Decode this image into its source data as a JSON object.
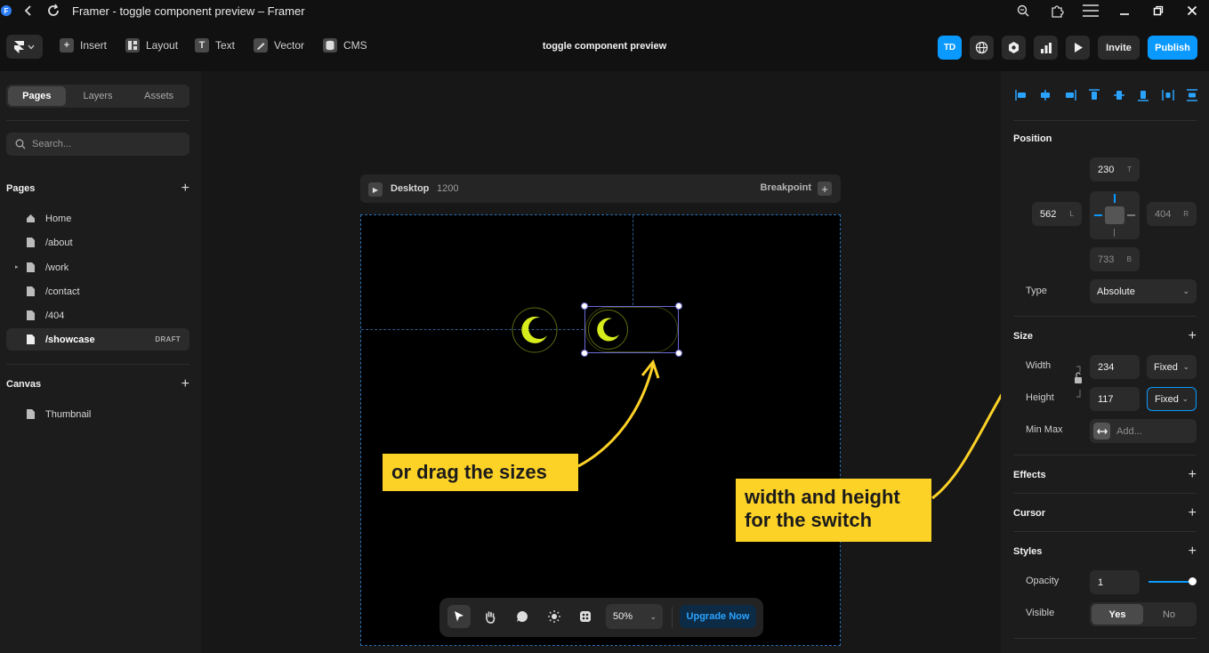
{
  "window": {
    "title": "Framer - toggle component preview – Framer"
  },
  "toolbar": {
    "insert": "Insert",
    "layout": "Layout",
    "text": "Text",
    "vector": "Vector",
    "cms": "CMS",
    "project_title": "toggle component preview",
    "avatar": "TD",
    "invite": "Invite",
    "publish": "Publish"
  },
  "left": {
    "tabs": [
      "Pages",
      "Layers",
      "Assets"
    ],
    "search_placeholder": "Search...",
    "pages_heading": "Pages",
    "pages": [
      {
        "label": "Home",
        "icon": "home-icon"
      },
      {
        "label": "/about",
        "icon": "page-icon"
      },
      {
        "label": "/work",
        "icon": "page-icon"
      },
      {
        "label": "/contact",
        "icon": "page-icon"
      },
      {
        "label": "/404",
        "icon": "page-icon"
      },
      {
        "label": "/showcase",
        "icon": "page-icon",
        "badge": "DRAFT"
      }
    ],
    "canvas_heading": "Canvas",
    "canvas_items": [
      "Thumbnail"
    ]
  },
  "canvas": {
    "frame_name": "Desktop",
    "frame_width": "1200",
    "breakpoint": "Breakpoint",
    "callout_left": "or drag the sizes",
    "callout_right_line1": "width and height",
    "callout_right_line2": "for the switch",
    "zoom": "50%",
    "upgrade": "Upgrade Now",
    "accent_yellow": "#fdd227",
    "moon_color": "#d7ec1c"
  },
  "right": {
    "position_heading": "Position",
    "top": "230",
    "top_suffix": "T",
    "left": "562",
    "left_suffix": "L",
    "right": "404",
    "right_suffix": "R",
    "bottom": "733",
    "bottom_suffix": "B",
    "type_label": "Type",
    "type_value": "Absolute",
    "size_heading": "Size",
    "width_label": "Width",
    "width_value": "234",
    "width_mode": "Fixed",
    "height_label": "Height",
    "height_value": "117",
    "height_mode": "Fixed",
    "minmax_label": "Min Max",
    "minmax_placeholder": "Add...",
    "effects_heading": "Effects",
    "cursor_heading": "Cursor",
    "styles_heading": "Styles",
    "opacity_label": "Opacity",
    "opacity_value": "1",
    "visible_label": "Visible",
    "visible_yes": "Yes",
    "visible_no": "No",
    "accent_blue": "#0a99ff"
  }
}
